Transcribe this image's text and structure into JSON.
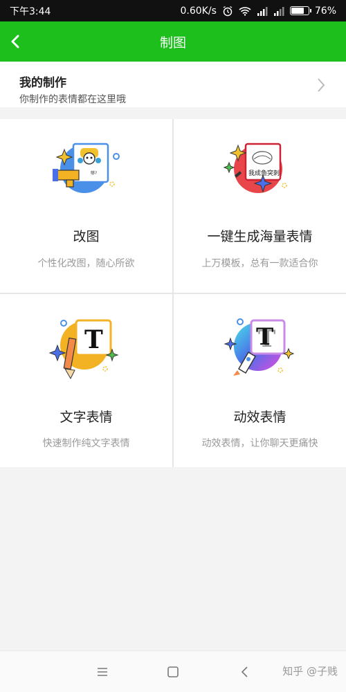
{
  "status": {
    "time": "下午3:44",
    "speed": "0.60K/s",
    "battery": "76%"
  },
  "header": {
    "title": "制图"
  },
  "my_work": {
    "title": "我的制作",
    "subtitle": "你制作的表情都在这里哦"
  },
  "cards": [
    {
      "name": "改图",
      "desc": "个性化改图，随心所欲",
      "icon_text": "够?"
    },
    {
      "name": "一键生成海量表情",
      "desc": "上万模板，总有一款适合你",
      "icon_text": "我成鱼突刺"
    },
    {
      "name": "文字表情",
      "desc": "快速制作纯文字表情",
      "icon_text": "T"
    },
    {
      "name": "动效表情",
      "desc": "动效表情，让你聊天更痛快",
      "icon_text": "T"
    }
  ],
  "watermark": "知乎 @子贱",
  "colors": {
    "brand": "#1dbf1d"
  }
}
